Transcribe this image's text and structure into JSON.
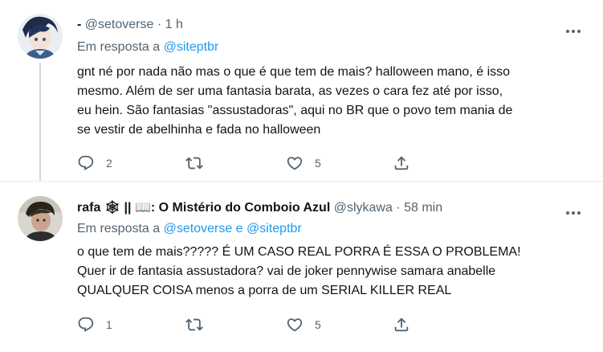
{
  "tweet1": {
    "name": "-",
    "handle": "@setoverse",
    "separator": "·",
    "time": "1 h",
    "reply_prefix": "Em resposta a",
    "reply_mention_1": "@siteptbr",
    "text": "gnt né por nada não mas o que é que tem de mais? halloween mano, é isso\nmesmo. Além de ser uma fantasia barata, as vezes o cara fez até por isso,\neu hein. São fantasias \"assustadoras\", aqui no BR que o povo tem mania de\nse vestir de abelhinha e fada no halloween",
    "replies": "2",
    "retweets": "",
    "likes": "5"
  },
  "tweet2": {
    "name": "rafa 🕸 || 📖: O Mistério do Comboio Azul",
    "handle": "@slykawa",
    "separator": "·",
    "time": "58 min",
    "reply_prefix": "Em resposta a",
    "reply_mention_1": "@setoverse",
    "reply_conj": "e",
    "reply_mention_2": "@siteptbr",
    "text": "o que tem de mais????? É UM CASO REAL PORRA É ESSA O PROBLEMA!\nQuer ir de fantasia assustadora? vai de joker pennywise samara anabelle\nQUALQUER COISA menos a porra de um SERIAL KILLER REAL",
    "replies": "1",
    "retweets": "",
    "likes": "5"
  },
  "icons": {
    "reply": "reply-icon",
    "retweet": "retweet-icon",
    "like": "like-icon",
    "share": "share-icon",
    "more": "more-icon"
  },
  "colors": {
    "link": "#1d9bf0",
    "secondary_text": "#536471",
    "primary_text": "#0f1419",
    "divider": "#e6ecf0"
  }
}
